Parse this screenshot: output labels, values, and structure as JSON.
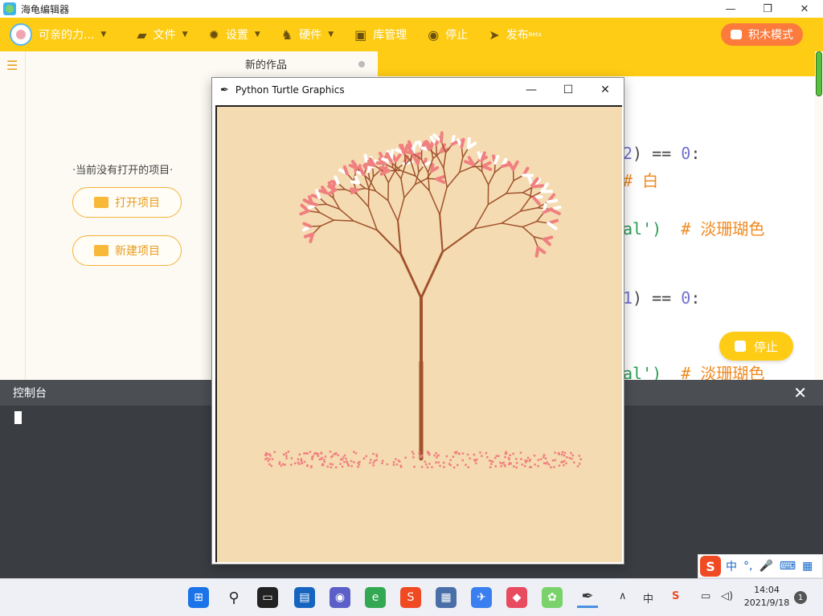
{
  "window": {
    "title": "海龟编辑器",
    "minimize": "—",
    "maximize": "❐",
    "close": "✕"
  },
  "toolbar": {
    "user": "可亲的力...",
    "file": "文件",
    "settings": "设置",
    "hardware": "硬件",
    "library": "库管理",
    "stop": "停止",
    "publish": "发布",
    "publish_badge": "Beta",
    "block_mode": "积木模式"
  },
  "left_panel": {
    "no_project": "·当前没有打开的项目·",
    "open_project": "打开项目",
    "new_project": "新建项目"
  },
  "editor": {
    "tab_title": "新的作品",
    "lines": [
      {
        "num": "2",
        "rest": ") == ",
        "zero": "0",
        "tail": ":"
      },
      {
        "comment": "# 白"
      },
      {
        "str": "al')",
        "comment": "# 淡珊瑚色"
      },
      {
        "num": "1",
        "rest": ") == ",
        "zero": "0",
        "tail": ":"
      },
      {
        "str": "al')",
        "comment": "# 淡珊瑚色"
      }
    ],
    "stop_button": "停止"
  },
  "console": {
    "title": "控制台",
    "close": "✕"
  },
  "turtle_window": {
    "title": "Python Turtle Graphics",
    "minimize": "—",
    "maximize": "☐",
    "close": "✕",
    "colors": {
      "background": "#f5dbb1",
      "trunk": "#a0522d",
      "blossom": "#f08080",
      "white": "#ffffff"
    }
  },
  "ime": {
    "lang": "中",
    "punct": "°,",
    "mic": "🎤",
    "keyboard": "⌨",
    "grid": "▦"
  },
  "taskbar": {
    "time": "14:04",
    "date": "2021/9/18",
    "notifications": "1",
    "tray_lang": "中",
    "icons": [
      "windows-start-icon",
      "search-icon",
      "task-view-icon",
      "widgets-icon",
      "teams-icon",
      "edge-icon",
      "sogou-icon",
      "remote-desktop-icon",
      "feishu-icon",
      "game-icon",
      "turtle-editor-icon",
      "python-feather-icon"
    ]
  }
}
